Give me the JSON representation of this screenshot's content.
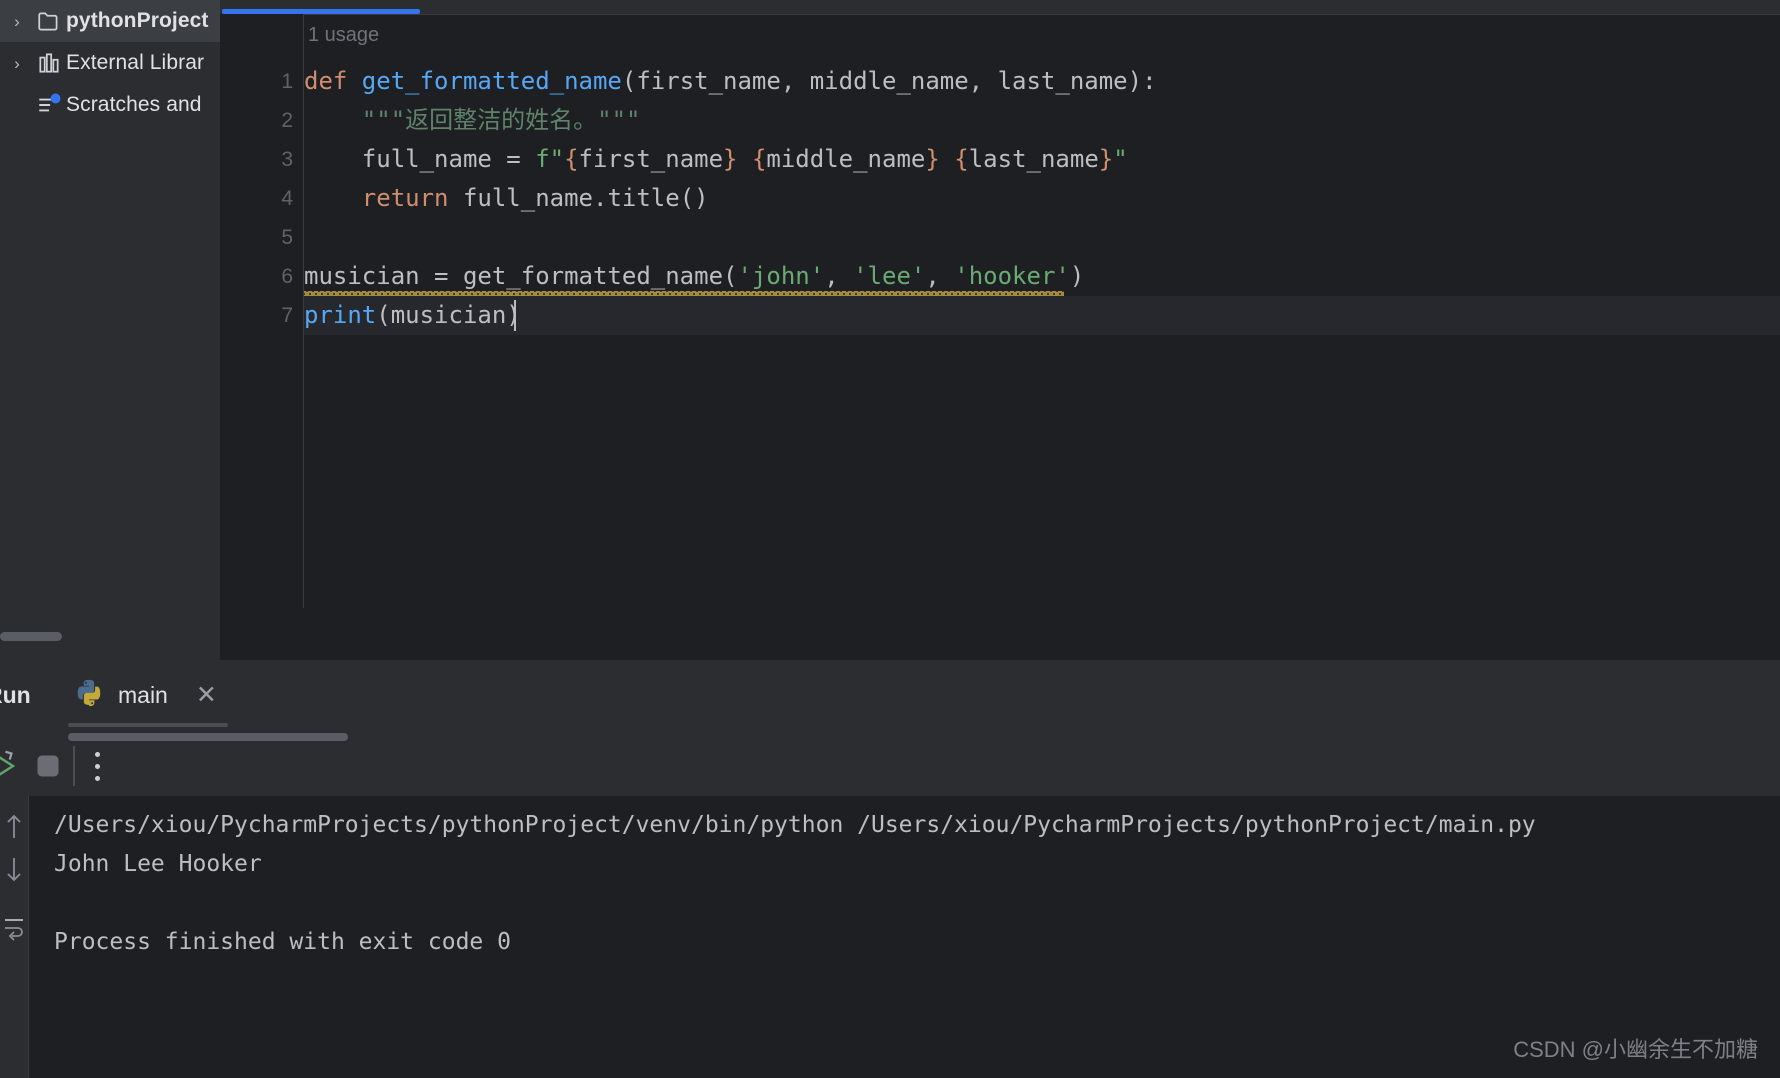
{
  "sidebar": {
    "items": [
      {
        "label": "pythonProject",
        "icon": "folder-icon",
        "arrow": "›",
        "selected": true,
        "bold": true
      },
      {
        "label": "External Librar",
        "icon": "library-icon",
        "arrow": "›",
        "selected": false,
        "bold": false
      },
      {
        "label": "Scratches and",
        "icon": "scratches-icon",
        "arrow": "",
        "selected": false,
        "bold": false
      }
    ]
  },
  "editor": {
    "usage_hint": "1 usage",
    "line_numbers": [
      "1",
      "2",
      "3",
      "4",
      "5",
      "6",
      "7"
    ],
    "code_lines": [
      {
        "n": 1,
        "tokens": [
          {
            "t": "def ",
            "c": "tok-kw"
          },
          {
            "t": "get_formatted_name",
            "c": "tok-fn"
          },
          {
            "t": "(first_name, middle_name, last_name):",
            "c": "tok-txt"
          }
        ]
      },
      {
        "n": 2,
        "tokens": [
          {
            "t": "    \"\"\"返回整洁的姓名。\"\"\"",
            "c": "tok-doc"
          }
        ]
      },
      {
        "n": 3,
        "tokens": [
          {
            "t": "    full_name = ",
            "c": "tok-txt"
          },
          {
            "t": "f\"",
            "c": "tok-str"
          },
          {
            "t": "{",
            "c": "tok-brace"
          },
          {
            "t": "first_name",
            "c": "tok-txt"
          },
          {
            "t": "}",
            "c": "tok-brace"
          },
          {
            "t": " ",
            "c": "tok-str"
          },
          {
            "t": "{",
            "c": "tok-brace"
          },
          {
            "t": "middle_name",
            "c": "tok-txt"
          },
          {
            "t": "}",
            "c": "tok-brace"
          },
          {
            "t": " ",
            "c": "tok-str"
          },
          {
            "t": "{",
            "c": "tok-brace"
          },
          {
            "t": "last_name",
            "c": "tok-txt"
          },
          {
            "t": "}",
            "c": "tok-brace"
          },
          {
            "t": "\"",
            "c": "tok-str"
          }
        ]
      },
      {
        "n": 4,
        "tokens": [
          {
            "t": "    return ",
            "c": "tok-kw"
          },
          {
            "t": "full_name.title()",
            "c": "tok-txt"
          }
        ]
      },
      {
        "n": 5,
        "tokens": [
          {
            "t": "",
            "c": "tok-txt"
          }
        ]
      },
      {
        "n": 6,
        "tokens": [
          {
            "t": "musician = get_formatted_name(",
            "c": "tok-txt"
          },
          {
            "t": "'john'",
            "c": "tok-str"
          },
          {
            "t": ", ",
            "c": "tok-txt"
          },
          {
            "t": "'lee'",
            "c": "tok-str"
          },
          {
            "t": ", ",
            "c": "tok-txt"
          },
          {
            "t": "'hooker'",
            "c": "tok-str"
          },
          {
            "t": ")",
            "c": "tok-txt"
          }
        ]
      },
      {
        "n": 7,
        "tokens": [
          {
            "t": "print",
            "c": "tok-fn"
          },
          {
            "t": "(musician)",
            "c": "tok-txt"
          }
        ]
      }
    ]
  },
  "run_panel": {
    "title": "Run",
    "tab_label": "main",
    "tab_icon": "python-logo-icon",
    "close_label": "✕",
    "toolbar": {
      "rerun_label": "rerun-icon",
      "stop_label": "stop-icon",
      "more_label": "more-options-icon"
    },
    "gutter_icons": [
      "scroll-up-icon",
      "scroll-down-icon",
      "soft-wrap-icon"
    ],
    "console_lines": [
      "/Users/xiou/PycharmProjects/pythonProject/venv/bin/python /Users/xiou/PycharmProjects/pythonProject/main.py",
      "John Lee Hooker",
      "",
      "Process finished with exit code 0"
    ]
  },
  "watermark": "CSDN @小幽余生不加糖",
  "colors": {
    "accent_blue": "#3574f0",
    "editor_bg": "#1e1f22",
    "panel_bg": "#2b2d30",
    "keyword": "#cf8e6d",
    "function": "#56a8f5",
    "string": "#6aab73",
    "text": "#bcbec4",
    "warning": "#a58c3c"
  }
}
